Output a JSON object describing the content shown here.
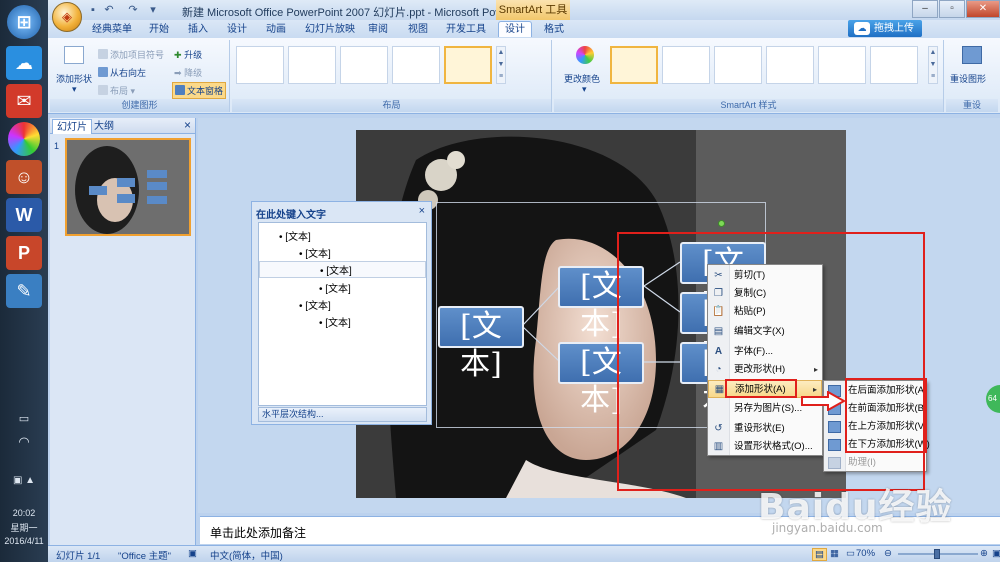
{
  "window": {
    "title": "新建 Microsoft Office PowerPoint 2007 幻灯片.ppt - Microsoft PowerPoi...",
    "context_tool": "SmartArt 工具",
    "upload_label": "拖拽上传",
    "upload_icon": "cloud-icon"
  },
  "tabs": [
    "经典菜单",
    "开始",
    "插入",
    "设计",
    "动画",
    "幻灯片放映",
    "审阅",
    "视图",
    "开发工具",
    "设计",
    "格式"
  ],
  "active_tab_index": 9,
  "ribbon": {
    "create_group": {
      "label": "创建图形",
      "add_shape": "添加形状",
      "add_bullet": "添加项目符号",
      "right_to_left": "从右向左",
      "layout": "布局",
      "promote": "升级",
      "demote": "降级",
      "text_pane": "文本窗格"
    },
    "layout_group": {
      "label": "布局"
    },
    "styles_group": {
      "label": "SmartArt 样式",
      "change_colors": "更改颜色"
    },
    "reset_group": {
      "label": "重设",
      "reset_graphic": "重设图形"
    }
  },
  "slides_panel": {
    "tabs": [
      "幻灯片",
      "大纲"
    ],
    "close": "×",
    "slide_number": "1"
  },
  "text_pane": {
    "title": "在此处键入文字",
    "close": "×",
    "lines": [
      "[文本]",
      "[文本]",
      "[文本]",
      "[文本]",
      "[文本]",
      "[文本]"
    ],
    "footer": "水平层次结构..."
  },
  "smartart": {
    "box_text": "[文本]"
  },
  "context_menu": {
    "items": [
      "剪切(T)",
      "复制(C)",
      "粘贴(P)",
      "编辑文字(X)",
      "字体(F)...",
      "更改形状(H)",
      "添加形状(A)",
      "另存为图片(S)...",
      "重设形状(E)",
      "设置形状格式(O)..."
    ],
    "highlighted_index": 6
  },
  "submenu": {
    "items": [
      "在后面添加形状(A)",
      "在前面添加形状(B)",
      "在上方添加形状(V)",
      "在下方添加形状(W)",
      "助理(I)"
    ]
  },
  "notes": {
    "placeholder": "单击此处添加备注"
  },
  "status": {
    "slide_info": "幻灯片 1/1",
    "theme": "\"Office 主题\"",
    "language": "中文(简体，中国)",
    "zoom": "70%"
  },
  "desktop": {
    "time": "20:02",
    "weekday": "星期一",
    "date": "2016/4/11"
  },
  "watermark": {
    "brand": "Baidu经验",
    "url": "jingyan.baidu.com"
  },
  "colors": {
    "highlight_red": "#e0201b",
    "accent_blue": "#15428b",
    "smartart_blue": "#4f7fbf"
  }
}
